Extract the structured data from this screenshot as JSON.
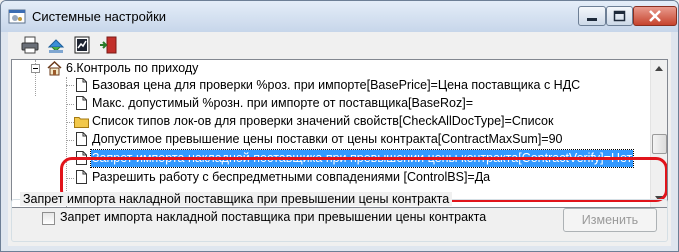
{
  "window": {
    "title": "Системные настройки"
  },
  "toolbar": {
    "buttons": [
      {
        "icon": "printer-icon"
      },
      {
        "icon": "refresh-icon"
      },
      {
        "icon": "report-icon"
      },
      {
        "icon": "exit-door-icon"
      }
    ]
  },
  "tree": {
    "items": [
      {
        "label": "6.Контроль по приходу",
        "icon": "house-icon",
        "expander": "minus"
      },
      {
        "label": "Базовая цена для проверки %роз. при импорте[BasePrice]=Цена поставщика с НДС",
        "icon": "document-icon"
      },
      {
        "label": "Макс. допустимый %розн. при импорте от поставщика[BaseRoz]=",
        "icon": "document-icon"
      },
      {
        "label": "Список типов лок-ов для проверки значений свойств[CheckAllDocType]=Список",
        "icon": "folder-icon"
      },
      {
        "label": "Допустимое превышение цены поставки от цены контракта[ContractMaxSum]=90",
        "icon": "document-icon"
      },
      {
        "label": "Запрет импорта накладной поставщика при превышении цены контракта[ContractVerify]=Нет",
        "icon": "document-icon",
        "selected": true
      },
      {
        "label": "Разрешить работу с  беспредметными совпадениями [ControlBS]=Да",
        "icon": "document-icon"
      }
    ]
  },
  "group": {
    "title": "Запрет импорта накладной поставщика при превышении цены контракта",
    "checkbox_label": "Запрет импорта накладной поставщика при превышении цены контракта",
    "checkbox_checked": false,
    "change_button": "Изменить"
  },
  "colors": {
    "selection": "#3399ff",
    "highlight_outline": "#e1141b",
    "titlebar": "#c7d6ea"
  }
}
